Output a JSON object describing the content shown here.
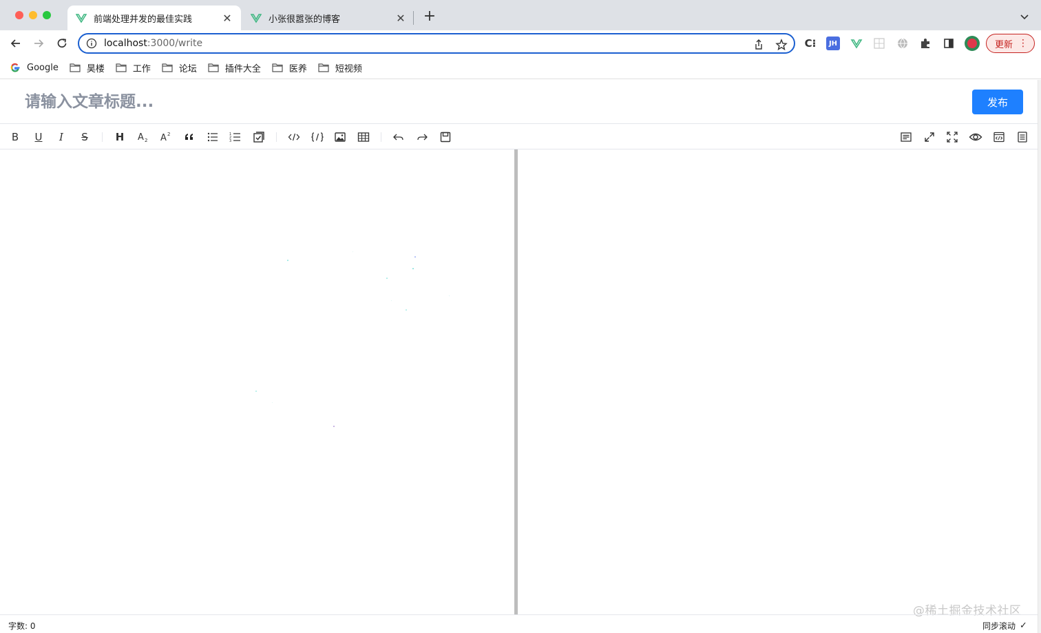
{
  "browser": {
    "tabs": [
      {
        "title": "前端处理并发的最佳实践",
        "active": true
      },
      {
        "title": "小张很嚣张的博客",
        "active": false
      }
    ],
    "new_tab": "+",
    "url_host": "localhost",
    "url_path": ":3000/write",
    "update_label": "更新",
    "bookmarks": [
      "Google",
      "昊楼",
      "工作",
      "论坛",
      "插件大全",
      "医养",
      "短视频"
    ],
    "extensions": {
      "jh": "JH"
    }
  },
  "editor": {
    "title_placeholder": "请输入文章标题...",
    "publish_label": "发布",
    "toolbar": {
      "bold": "B",
      "underline": "U",
      "italic": "I",
      "strike": "S",
      "heading": "H"
    },
    "status": {
      "word_count": "字数: 0",
      "sync_scroll": "同步滚动",
      "sync_check": "✓"
    },
    "watermark": "@稀土掘金技术社区"
  },
  "colors": {
    "accent": "#1e80ff",
    "splitter": "#bdbdbd",
    "omnibox_border": "#1a5fd0",
    "update": "#c5221f"
  }
}
